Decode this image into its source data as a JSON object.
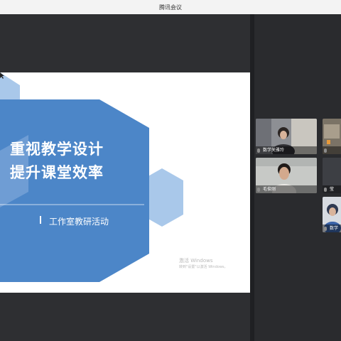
{
  "window": {
    "title": "腾讯会议"
  },
  "slide": {
    "title_line1": "重视教学设计",
    "title_line2": "提升课堂效率",
    "subtitle": "工作室教研活动",
    "watermark_line1": "激活 Windows",
    "watermark_line2": "转到\"设置\"以激活 Windows。"
  },
  "participants": [
    {
      "name": "数学关雅玲",
      "mic_on": true
    },
    {
      "name": "",
      "mic_on": true
    },
    {
      "name": "毛俊刚",
      "mic_on": true
    },
    {
      "name": "莹",
      "mic_on": true
    },
    {
      "name": "数学",
      "mic_on": true
    }
  ],
  "colors": {
    "slide_blue": "#4c86c8",
    "slide_light_blue": "#a9c8ea",
    "tile_bg": "#4a4c52"
  }
}
